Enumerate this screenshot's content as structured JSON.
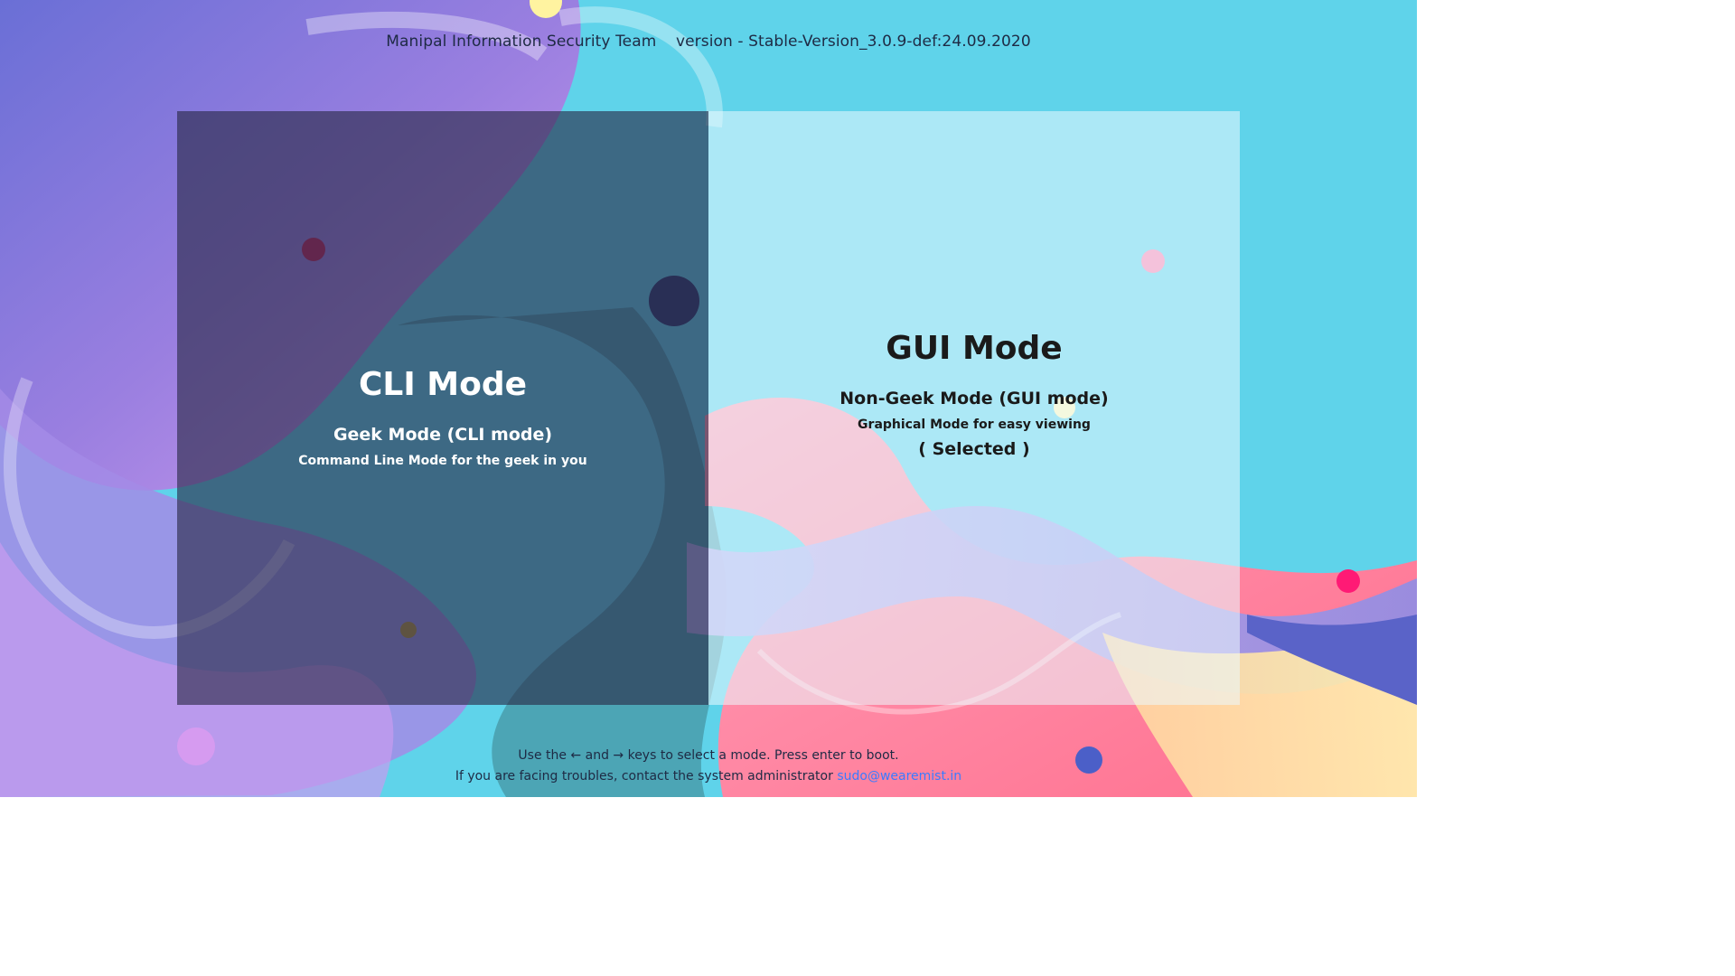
{
  "header": {
    "team": "Manipal Information Security Team",
    "version": "version - Stable-Version_3.0.9-def:24.09.2020"
  },
  "modes": {
    "cli": {
      "title": "CLI Mode",
      "subtitle": "Geek Mode (CLI mode)",
      "description": "Command Line Mode for the geek in you"
    },
    "gui": {
      "title": "GUI Mode",
      "subtitle": "Non-Geek Mode (GUI mode)",
      "description": "Graphical Mode for easy viewing",
      "selected_label": "( Selected )"
    }
  },
  "footer": {
    "instructions": "Use the ← and → keys to select a mode. Press enter to boot.",
    "contact_prefix": "If you are facing troubles, contact the system administrator",
    "contact_email": "sudo@wearemist.in"
  },
  "colors": {
    "background": "#5fd3ea",
    "link": "#3a7bff",
    "cli_panel": "#28284a",
    "gui_panel": "#ebfaff"
  }
}
